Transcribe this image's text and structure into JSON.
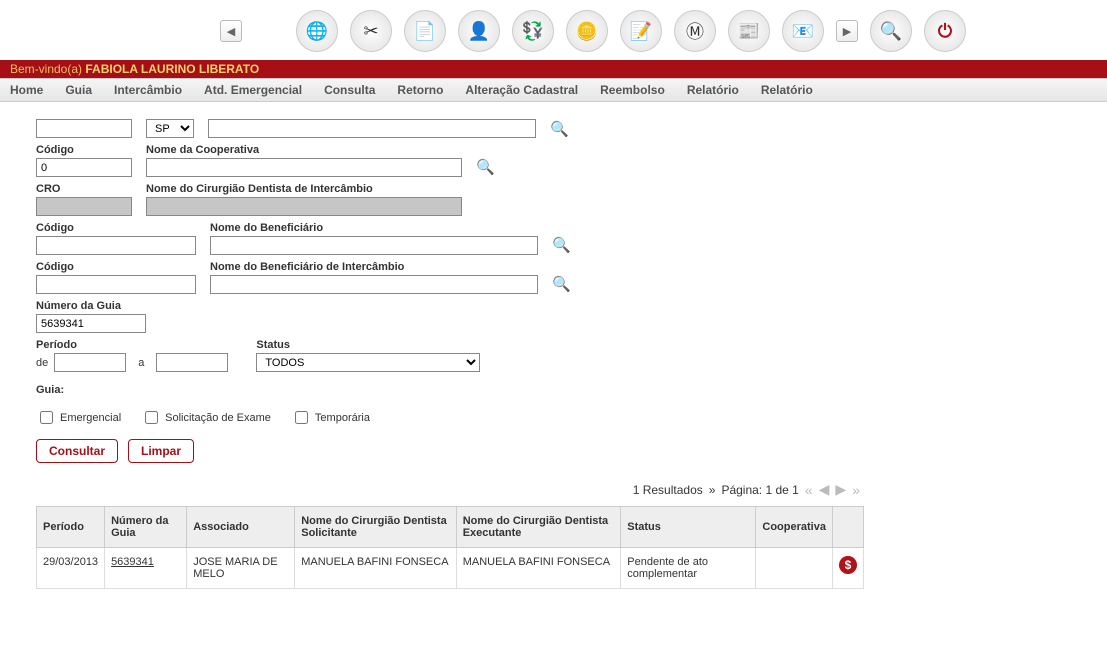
{
  "welcome": {
    "prefix": "Bem-vindo(a)",
    "name": "FABIOLA LAURINO LIBERATO"
  },
  "menu": [
    "Home",
    "Guia",
    "Intercâmbio",
    "Atd. Emergencial",
    "Consulta",
    "Retorno",
    "Alteração Cadastral",
    "Reembolso",
    "Relatório",
    "Relatório"
  ],
  "top_icons": [
    {
      "name": "nav-back",
      "glyph": "◀"
    },
    {
      "name": "globe-icon",
      "glyph": "🌐"
    },
    {
      "name": "tools-icon",
      "glyph": "✂"
    },
    {
      "name": "doc-icon",
      "glyph": "📄"
    },
    {
      "name": "person-icon",
      "glyph": "👤"
    },
    {
      "name": "money-icon",
      "glyph": "💱"
    },
    {
      "name": "coins-icon",
      "glyph": "🪙"
    },
    {
      "name": "edit-icon",
      "glyph": "📝"
    },
    {
      "name": "m-icon",
      "glyph": "Ⓜ"
    },
    {
      "name": "news-icon",
      "glyph": "📰"
    },
    {
      "name": "mail-icon",
      "glyph": "📧"
    },
    {
      "name": "nav-fwd",
      "glyph": "▶"
    },
    {
      "name": "search-top-icon",
      "glyph": "🔍"
    },
    {
      "name": "power-icon",
      "glyph": "⏻"
    }
  ],
  "form": {
    "uf_label": "",
    "uf_value": "SP",
    "codigo1_label": "Código",
    "codigo1_value": "0",
    "coop_label": "Nome da Cooperativa",
    "cro_label": "CRO",
    "cd_inter_label": "Nome do Cirurgião Dentista de Intercâmbio",
    "codigo2_label": "Código",
    "benef_label": "Nome do Beneficiário",
    "codigo3_label": "Código",
    "benef_inter_label": "Nome do Beneficiário de Intercâmbio",
    "numguia_label": "Número da Guia",
    "numguia_value": "5639341",
    "periodo_label": "Período",
    "de": "de",
    "a": "a",
    "status_label": "Status",
    "status_value": "TODOS",
    "guia_label": "Guia:",
    "chk_emergencial": "Emergencial",
    "chk_solic": "Solicitação de Exame",
    "chk_temp": "Temporária",
    "btn_consultar": "Consultar",
    "btn_limpar": "Limpar"
  },
  "pager": {
    "results": "1 Resultados",
    "sep": "»",
    "page": "Página: 1 de 1"
  },
  "table": {
    "headers": [
      "Período",
      "Número da Guia",
      "Associado",
      "Nome do Cirurgião Dentista Solicitante",
      "Nome do Cirurgião Dentista Executante",
      "Status",
      "Cooperativa",
      ""
    ],
    "rows": [
      {
        "periodo": "29/03/2013",
        "numero": "5639341",
        "associado": "JOSE MARIA DE MELO",
        "solicitante": "MANUELA BAFINI FONSECA",
        "executante": "MANUELA BAFINI FONSECA",
        "status": "Pendente de ato complementar",
        "cooperativa": "",
        "action_glyph": "$"
      }
    ]
  }
}
